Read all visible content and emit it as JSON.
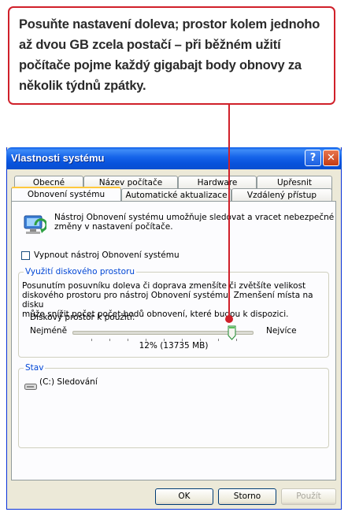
{
  "callout": {
    "lines": [
      "Posuňte nastavení doleva; prostor kolem jednoho",
      "až dvou GB zcela postačí – při běžném užití",
      "počítače pojme každý gigabajt body obnovy za",
      "několik týdnů zpátky."
    ]
  },
  "window": {
    "title": "Vlastnosti systému",
    "help_glyph": "?",
    "close_glyph": "✕"
  },
  "tabs": {
    "row1": [
      "Obecné",
      "Název počítače",
      "Hardware",
      "Upřesnit"
    ],
    "row2": [
      "Obnovení systému",
      "Automatické aktualizace",
      "Vzdálený přístup"
    ]
  },
  "intro": {
    "line1": "Nástroj Obnovení systému umožňuje sledovat a vracet nebezpečné",
    "line2": "změny v nastavení počítače."
  },
  "disable_checkbox": {
    "label": "Vypnout nástroj Obnovení systému",
    "checked": false
  },
  "disk_group": {
    "title": "Využití diskového prostoru",
    "desc1": "Posunutím posuvníku doleva či doprava zmenšíte či zvětšíte velikost",
    "desc2": "diskového prostoru pro nástroj Obnovení systému. Zmenšení místa na disku",
    "desc3": "může snížit počet počet bodů obnovení, které budou k dispozici.",
    "slider_label": "Diskový prostor k použití:",
    "min_label": "Nejméně",
    "max_label": "Nejvíce",
    "value_text": "12% (13735 MB)",
    "slider_position": 0.9
  },
  "status_group": {
    "title": "Stav",
    "drive_label": "(C:) Sledování"
  },
  "buttons": {
    "ok": "OK",
    "cancel": "Storno",
    "apply": "Použít"
  },
  "colors": {
    "accent_red": "#d0202a",
    "xp_blue": "#0a5de9",
    "group_title": "#0046d5"
  }
}
